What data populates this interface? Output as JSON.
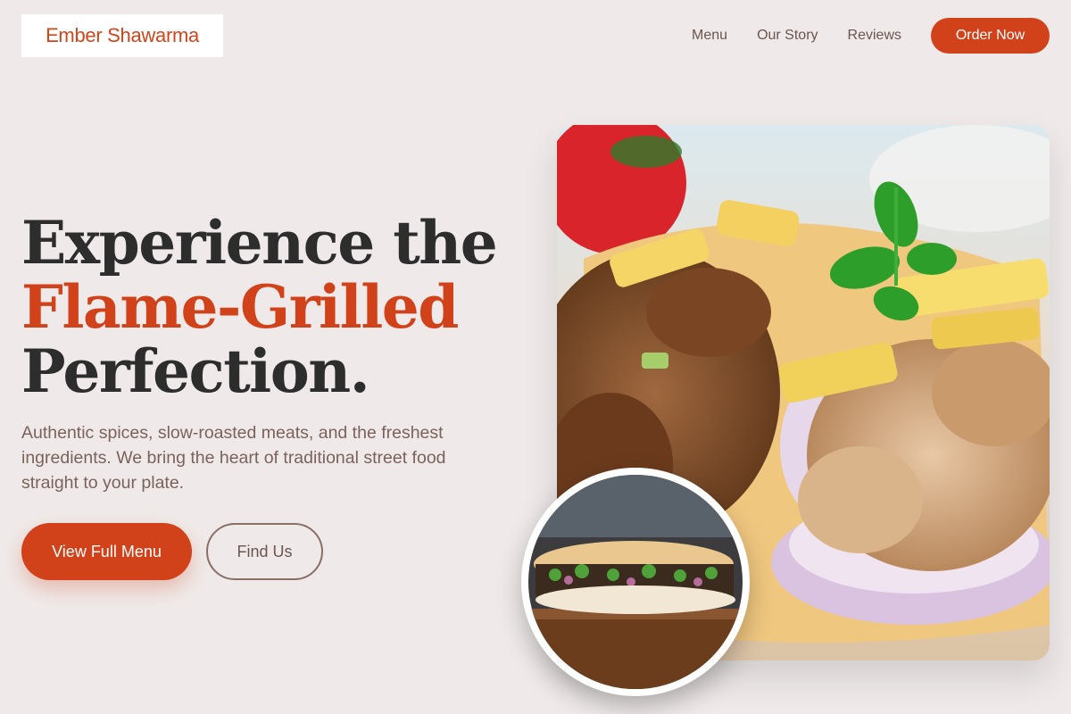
{
  "brand": {
    "name": "Ember Shawarma",
    "accent_color": "#d2421a"
  },
  "nav": {
    "links": [
      "Menu",
      "Our Story",
      "Reviews"
    ],
    "cta": "Order Now"
  },
  "hero": {
    "headline_line1": "Experience the",
    "headline_accent": "Flame-Grilled",
    "headline_line3": "Perfection.",
    "subtext": "Authentic spices, slow-roasted meats, and the freshest ingredients. We bring the heart of traditional street food straight to your plate.",
    "primary_button": "View Full Menu",
    "secondary_button": "Find Us"
  },
  "images": {
    "main": "shawarma-plate-photo",
    "thumbnail": "shawarma-sandwich-photo"
  }
}
